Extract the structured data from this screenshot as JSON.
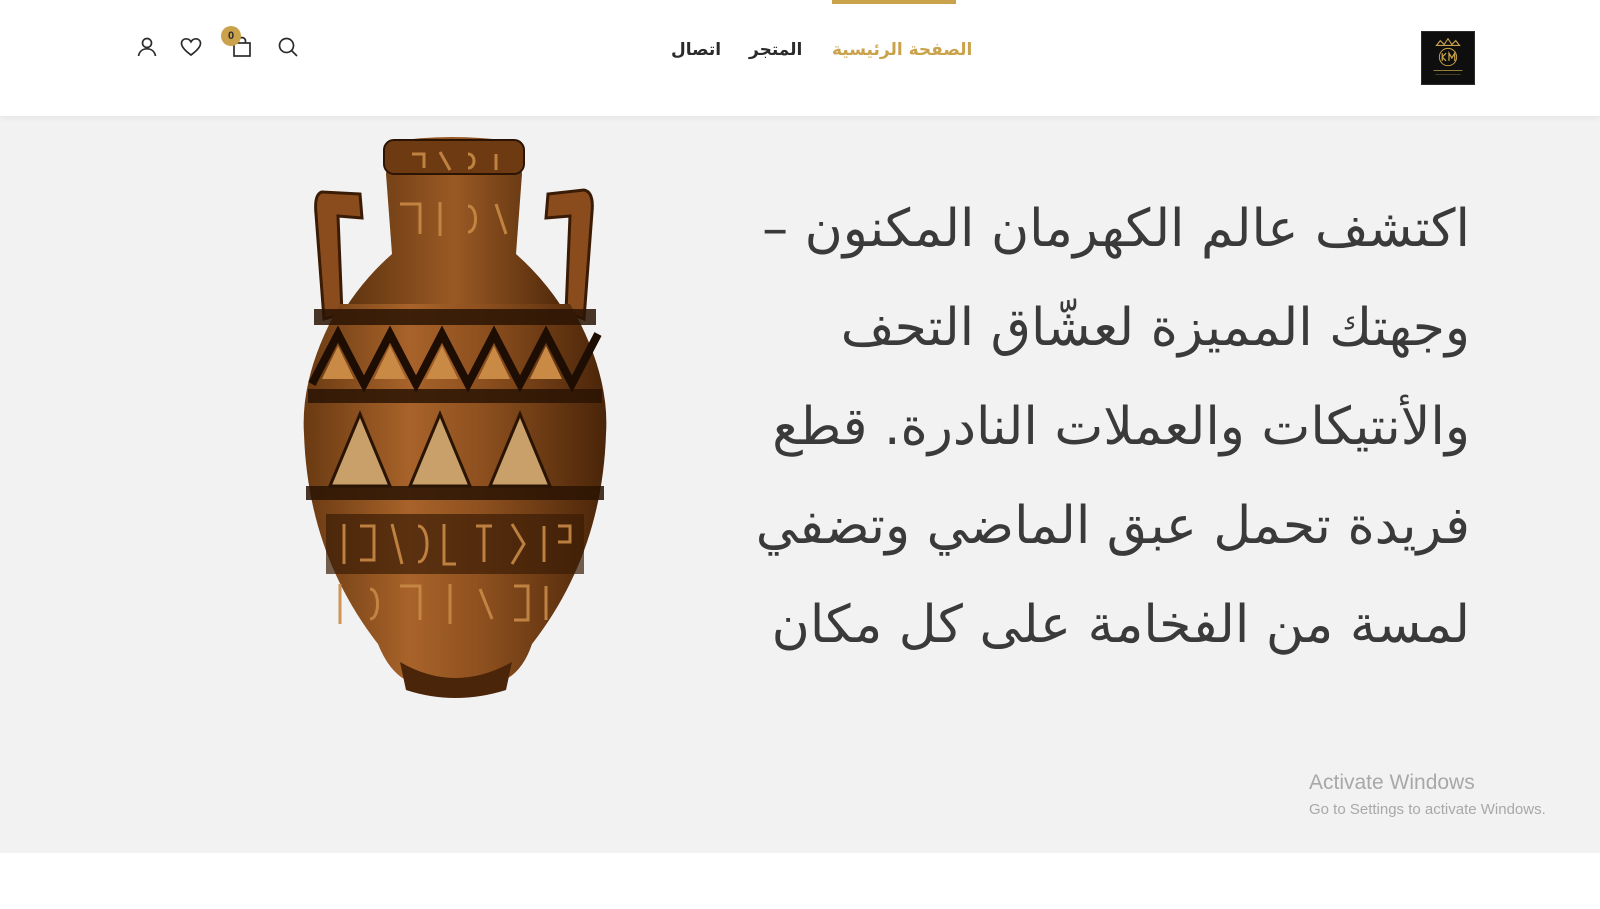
{
  "header": {
    "nav": [
      {
        "label": "الصفحة الرئيسية",
        "active": true
      },
      {
        "label": "المتجر",
        "active": false
      },
      {
        "label": "اتصال",
        "active": false
      }
    ],
    "icons": {
      "search": "search-icon",
      "cart": "shopping-bag-icon",
      "wishlist": "heart-icon",
      "account": "user-icon"
    },
    "cart_count": "0"
  },
  "hero": {
    "lines": [
      "اكتشف عالم الكهرمان المكنون –",
      "وجهتك المميزة لعشّاق التحف",
      "والأنتيكات والعملات النادرة. قطع",
      "فريدة تحمل عبق الماضي وتضفي",
      "لمسة من الفخامة على كل مكان"
    ]
  },
  "watermark": {
    "title": "Activate Windows",
    "subtitle": "Go to Settings to activate Windows."
  },
  "colors": {
    "accent": "#c9a24b",
    "text": "#2b2b2b",
    "hero_bg": "#f3f2f2"
  }
}
